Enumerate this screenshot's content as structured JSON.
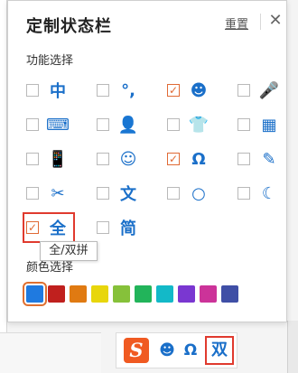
{
  "panel": {
    "title": "定制状态栏",
    "reset_label": "重置",
    "close_glyph": "✕",
    "section_label": "功能选择",
    "color_label": "颜色选择"
  },
  "options": [
    {
      "name": "chinese-mode",
      "icon": "中",
      "checked": false,
      "color": "#1a6fc9"
    },
    {
      "name": "punctuation",
      "icon": "°,",
      "checked": false,
      "color": "#1a6fc9"
    },
    {
      "name": "emoji",
      "icon": "☻",
      "checked": true,
      "color": "#1a6fc9"
    },
    {
      "name": "voice",
      "icon": "🎤",
      "checked": false,
      "color": "#1a6fc9"
    },
    {
      "name": "soft-keyboard",
      "icon": "⌨",
      "checked": false,
      "color": "#1a6fc9"
    },
    {
      "name": "user",
      "icon": "👤",
      "checked": false,
      "color": "#1a6fc9"
    },
    {
      "name": "skin",
      "icon": "👕",
      "checked": false,
      "color": "#1a6fc9"
    },
    {
      "name": "toolbox",
      "icon": "▦",
      "checked": false,
      "color": "#1a6fc9"
    },
    {
      "name": "devices",
      "icon": "📱",
      "checked": false,
      "color": "#1a6fc9"
    },
    {
      "name": "expression",
      "icon": "☺",
      "checked": false,
      "color": "#1a6fc9"
    },
    {
      "name": "special-symbols",
      "icon": "Ω",
      "checked": true,
      "color": "#1a6fc9"
    },
    {
      "name": "handwriting",
      "icon": "✎",
      "checked": false,
      "color": "#1a6fc9"
    },
    {
      "name": "screenshot",
      "icon": "✂",
      "checked": false,
      "color": "#1a6fc9"
    },
    {
      "name": "translate",
      "icon": "文",
      "checked": false,
      "color": "#1a6fc9"
    },
    {
      "name": "search",
      "icon": "○",
      "checked": false,
      "color": "#1a6fc9"
    },
    {
      "name": "night-mode",
      "icon": "☾",
      "checked": false,
      "color": "#1a6fc9"
    },
    {
      "name": "full-double-pinyin",
      "icon": "全",
      "checked": true,
      "highlighted": true,
      "color": "#1a6fc9"
    },
    {
      "name": "simplified",
      "icon": "简",
      "checked": false,
      "color": "#1a6fc9"
    }
  ],
  "tooltip": "全/双拼",
  "colors": [
    "#1f7ae0",
    "#c0201e",
    "#e07a12",
    "#e8d60c",
    "#86c13a",
    "#22b45a",
    "#13b9c8",
    "#7a37d1",
    "#cc3399",
    "#3f4fa6"
  ],
  "selected_color_index": 0,
  "statusbar": {
    "logo": "S",
    "icons": [
      "☻",
      "Ω"
    ],
    "mode": "双"
  }
}
